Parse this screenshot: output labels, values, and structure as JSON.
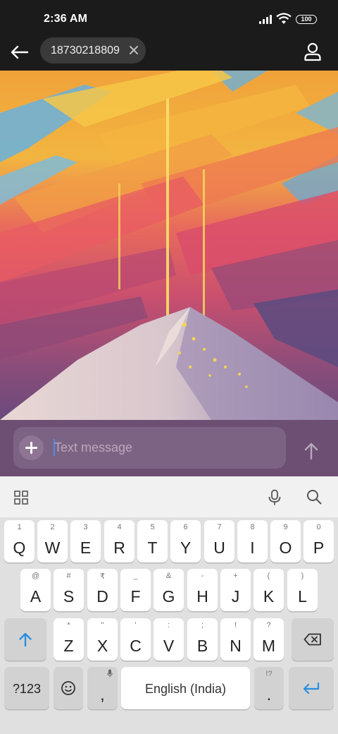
{
  "status_bar": {
    "time": "2:36 AM",
    "battery": "100",
    "icons": [
      "signal-icon",
      "wifi-icon",
      "battery-icon"
    ]
  },
  "app_bar": {
    "back_icon": "arrow-left-icon",
    "recipient": "18730218809",
    "remove_icon": "close-icon",
    "contact_icon": "person-icon"
  },
  "compose": {
    "attach_icon": "plus-icon",
    "placeholder": "Text message",
    "value": "",
    "send_icon": "arrow-up-icon"
  },
  "keyboard_toolbar": {
    "icons": [
      "grid-icon",
      "microphone-icon",
      "search-icon"
    ]
  },
  "keyboard": {
    "row1": [
      {
        "key": "Q",
        "hint": "1"
      },
      {
        "key": "W",
        "hint": "2"
      },
      {
        "key": "E",
        "hint": "3"
      },
      {
        "key": "R",
        "hint": "4"
      },
      {
        "key": "T",
        "hint": "5"
      },
      {
        "key": "Y",
        "hint": "6"
      },
      {
        "key": "U",
        "hint": "7"
      },
      {
        "key": "I",
        "hint": "8"
      },
      {
        "key": "O",
        "hint": "9"
      },
      {
        "key": "P",
        "hint": "0"
      }
    ],
    "row2": [
      {
        "key": "A",
        "hint": "@"
      },
      {
        "key": "S",
        "hint": "#"
      },
      {
        "key": "D",
        "hint": "₹"
      },
      {
        "key": "F",
        "hint": "_"
      },
      {
        "key": "G",
        "hint": "&"
      },
      {
        "key": "H",
        "hint": "-"
      },
      {
        "key": "J",
        "hint": "+"
      },
      {
        "key": "K",
        "hint": "("
      },
      {
        "key": "L",
        "hint": ")"
      }
    ],
    "row3": [
      {
        "key": "Z",
        "hint": "*"
      },
      {
        "key": "X",
        "hint": "\""
      },
      {
        "key": "C",
        "hint": "'"
      },
      {
        "key": "V",
        "hint": ":"
      },
      {
        "key": "B",
        "hint": ";"
      },
      {
        "key": "N",
        "hint": "!"
      },
      {
        "key": "M",
        "hint": "?"
      }
    ],
    "symbols_label": "?123",
    "comma_label": ",",
    "space_label": "English (India)",
    "period_label": ".",
    "period_hint": "!?",
    "accent_color": "#2a8ee0"
  }
}
